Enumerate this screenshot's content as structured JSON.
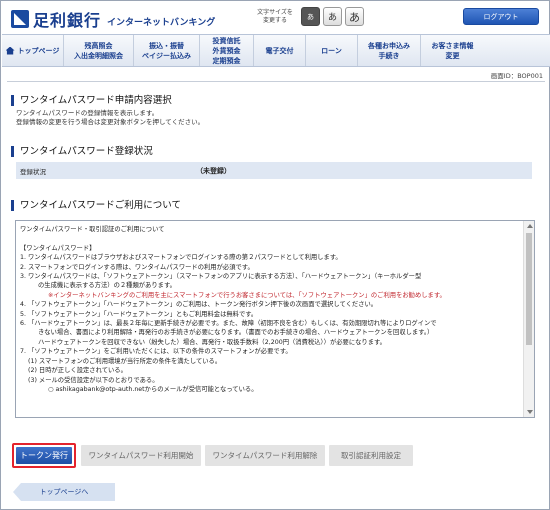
{
  "header": {
    "bank_name": "足利銀行",
    "service_name": "インターネットバンキング",
    "font_size_label": "文字サイズを\n変更する",
    "font_sizes": [
      "あ",
      "あ",
      "あ"
    ],
    "logout_label": "ログアウト"
  },
  "nav": {
    "items": [
      {
        "label": "トップページ"
      },
      {
        "label": "残高照会\n入出金明細照会"
      },
      {
        "label": "振込・振替\nペイジー払込み"
      },
      {
        "label": "投資信託\n外貨預金\n定期預金"
      },
      {
        "label": "電子交付"
      },
      {
        "label": "ローン"
      },
      {
        "label": "各種お申込み\n手続き"
      },
      {
        "label": "お客さま情報\n変更"
      }
    ]
  },
  "screen_id": "画面ID：BOP001",
  "section1": {
    "title": "ワンタイムパスワード申請内容選択",
    "desc_line1": "ワンタイムパスワードの登録情報を表示します。",
    "desc_line2": "登録情報の変更を行う場合は変更対象ボタンを押してください。"
  },
  "section2": {
    "title": "ワンタイムパスワード登録状況",
    "status_label": "登録状況",
    "status_value": "（未登録）"
  },
  "section3": {
    "title": "ワンタイムパスワードご利用について",
    "terms": [
      "ワンタイムパスワード・取引認証のご利用について",
      "",
      "【ワンタイムパスワード】",
      "1. ワンタイムパスワードはブラウザおよびスマートフォンでログインする際の第２パスワードとして利用します。",
      "2. スマートフォンでログインする際は、ワンタイムパスワードの利用が必須です。",
      "3. ワンタイムパスワードは、「ソフトウェアトークン」（スマートフォンのアプリに表示する方法）、「ハードウェアトークン」（キーホルダー型",
      "の生成機に表示する方法）の２種類があります。",
      "※インターネットバンキングのご利用を主にスマートフォンで行うお客さまについては、「ソフトウェアトークン」のご利用をお勧めします。",
      "4. 「ソフトウェアトークン」「ハードウェアトークン」のご利用は、トークン発行ボタン押下後の次画面で選択してください。",
      "5. 「ソフトウェアトークン」「ハードウェアトークン」ともご利用料金は無料です。",
      "6. 「ハードウェアトークン」は、最長２年毎に更新手続きが必要です。また、故障（初期不良を含む）もしくは、有効期限切れ等によりログインで",
      "きない場合、書面により利用解除・再発行のお手続きが必要になります。（書面でのお手続きの場合、ハードウェアトークンを回収します。）",
      "ハードウェアトークンを回収できない（紛失した）場合、再発行・取扱手数料（2,200円（消費税込））が必要になります。",
      "7. 「ソフトウェアトークン」をご利用いただくには、以下の条件のスマートフォンが必要です。",
      "(1) スマートフォンのご利用環境が当行所定の条件を満たしている。",
      "(2) 日時が正しく設定されている。",
      "(3) メールの受信設定が以下のとおりである。",
      "○ ashikagabank@otp-auth.netからのメールが受信可能となっている。"
    ]
  },
  "actions": {
    "issue_token": "トークン発行",
    "start_use": "ワンタイムパスワード利用開始",
    "cancel_use": "ワンタイムパスワード利用解除",
    "tx_auth_setting": "取引認証利用設定",
    "back_top": "トップページへ"
  }
}
